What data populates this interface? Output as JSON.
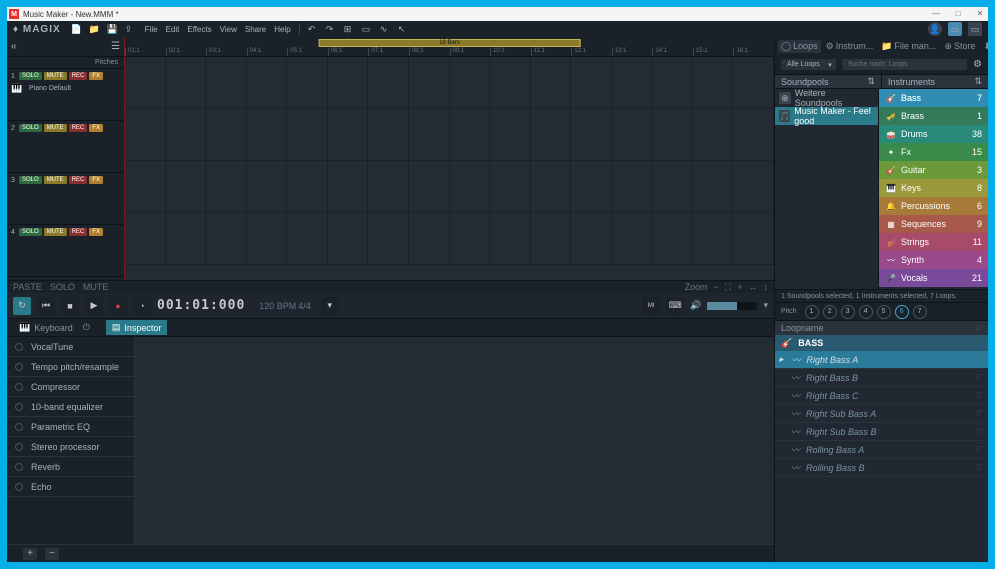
{
  "titlebar": {
    "app_icon_letter": "M",
    "title": "Music Maker - New.MMM *"
  },
  "brand": "♦ MAGIX",
  "menu": [
    "File",
    "Edit",
    "Effects",
    "View",
    "Share",
    "Help"
  ],
  "timeline": {
    "bar_label": "16 Bars",
    "marks": [
      "01:1",
      "02:1",
      "03:1",
      "04:1",
      "05:1",
      "06:1",
      "07:1",
      "08:1",
      "09:1",
      "10:1",
      "11:1",
      "12:1",
      "13:1",
      "14:1",
      "15:1",
      "16:1"
    ],
    "pitches_label": "Pitches"
  },
  "tracks": [
    {
      "num": "1",
      "name": "Piano Default"
    },
    {
      "num": "2",
      "name": ""
    },
    {
      "num": "3",
      "name": ""
    },
    {
      "num": "4",
      "name": ""
    }
  ],
  "track_btns": {
    "solo": "SOLO",
    "mute": "MUTE",
    "rec": "REC",
    "fx": "FX"
  },
  "transport": {
    "time": "001:01:000",
    "bpm": "120 BPM",
    "sig": "4/4",
    "zoom_label": "Zoom",
    "speaker_icon_label": "🔊"
  },
  "lower": {
    "tab_keyboard": "Keyboard",
    "tab_inspector": "Inspector",
    "fx": [
      "VocalTune",
      "Tempo pitch/resample",
      "Compressor",
      "10-band equalizer",
      "Parametric EQ",
      "Stereo processor",
      "Reverb",
      "Echo"
    ],
    "add": "+",
    "remove": "−"
  },
  "right": {
    "tabs": {
      "loops": "Loops",
      "instrum": "Instrum...",
      "filemgr": "File man...",
      "store": "Store",
      "downlo": "Downlo..."
    },
    "dropdown": "Alle Loops",
    "search_placeholder": "Suche nach: Loops",
    "col_soundpools": "Soundpools",
    "col_instruments": "Instruments",
    "soundpools": [
      {
        "label": "Weitere Soundpools",
        "selected": false
      },
      {
        "label": "Music Maker - Feel good",
        "selected": true
      }
    ],
    "instruments": [
      {
        "name": "Bass",
        "count": "7",
        "bg": "#2a7a9a",
        "icon": "🎸"
      },
      {
        "name": "Brass",
        "count": "1",
        "bg": "#327a5a",
        "icon": "🎺"
      },
      {
        "name": "Drums",
        "count": "38",
        "bg": "#2a8a7a",
        "icon": "🥁"
      },
      {
        "name": "Fx",
        "count": "15",
        "bg": "#3a8a4a",
        "icon": "✦"
      },
      {
        "name": "Guitar",
        "count": "3",
        "bg": "#6a9a3a",
        "icon": "🎸"
      },
      {
        "name": "Keys",
        "count": "8",
        "bg": "#9a9a3a",
        "icon": "🎹"
      },
      {
        "name": "Percussions",
        "count": "6",
        "bg": "#a87a3a",
        "icon": "🔔"
      },
      {
        "name": "Sequences",
        "count": "9",
        "bg": "#a85a4a",
        "icon": "▦"
      },
      {
        "name": "Strings",
        "count": "11",
        "bg": "#a84a6a",
        "icon": "🎻"
      },
      {
        "name": "Synth",
        "count": "4",
        "bg": "#9a4a8a",
        "icon": "〰"
      },
      {
        "name": "Vocals",
        "count": "21",
        "bg": "#7a4a9a",
        "icon": "🎤"
      }
    ],
    "status": "1 Soundpools selected, 1 Instruments selected, 7 Loops.",
    "pitch_label": "Pitch",
    "pitches": [
      "1",
      "2",
      "3",
      "4",
      "5",
      "6",
      "7"
    ],
    "pitch_active": "6",
    "loop_header": "Loopname",
    "loop_group": "BASS",
    "loops": [
      {
        "name": "Right Bass A",
        "selected": true
      },
      {
        "name": "Right Bass B",
        "selected": false
      },
      {
        "name": "Right Bass C",
        "selected": false
      },
      {
        "name": "Right Sub Bass A",
        "selected": false
      },
      {
        "name": "Right Sub Bass B",
        "selected": false
      },
      {
        "name": "Rolling Bass A",
        "selected": false
      },
      {
        "name": "Rolling Bass B",
        "selected": false
      }
    ]
  }
}
